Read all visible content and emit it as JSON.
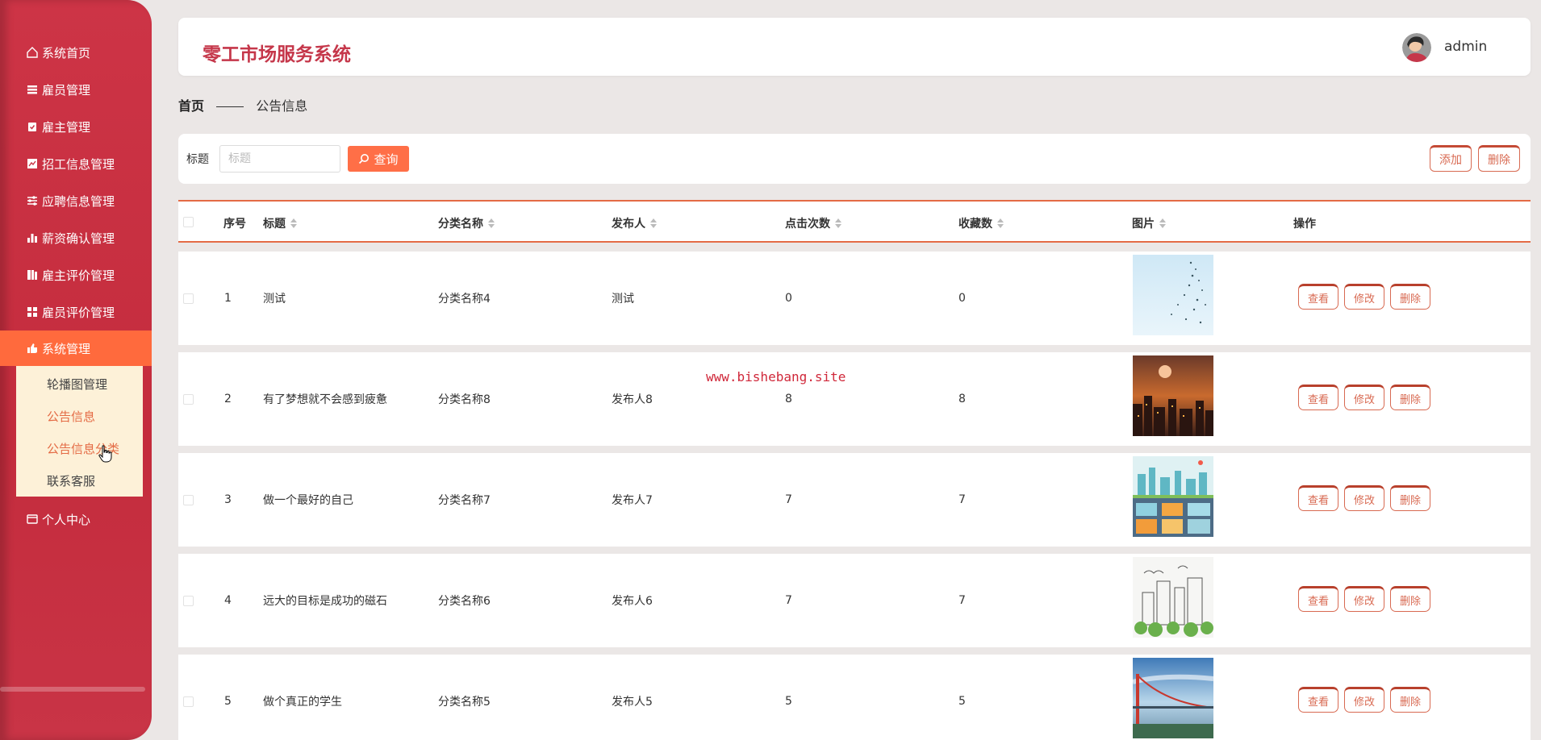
{
  "app": {
    "title": "零工市场服务系统",
    "username": "admin"
  },
  "sidebar": {
    "items": [
      {
        "label": "系统首页",
        "icon": "home-icon"
      },
      {
        "label": "雇员管理",
        "icon": "list-icon"
      },
      {
        "label": "雇主管理",
        "icon": "clipboard-icon"
      },
      {
        "label": "招工信息管理",
        "icon": "chart-icon"
      },
      {
        "label": "应聘信息管理",
        "icon": "sliders-icon"
      },
      {
        "label": "薪资确认管理",
        "icon": "bar-chart-icon"
      },
      {
        "label": "雇主评价管理",
        "icon": "book-icon"
      },
      {
        "label": "雇员评价管理",
        "icon": "grid-icon"
      },
      {
        "label": "系统管理",
        "icon": "thumbs-up-icon"
      },
      {
        "label": "个人中心",
        "icon": "card-icon"
      }
    ],
    "submenu": [
      "轮播图管理",
      "公告信息",
      "公告信息分类",
      "联系客服"
    ]
  },
  "breadcrumb": {
    "home": "首页",
    "current": "公告信息"
  },
  "search": {
    "label": "标题",
    "placeholder": "标题",
    "button": "查询",
    "add": "添加",
    "delete": "删除"
  },
  "table": {
    "columns": [
      "序号",
      "标题",
      "分类名称",
      "发布人",
      "点击次数",
      "收藏数",
      "图片",
      "操作"
    ],
    "rows": [
      {
        "no": "1",
        "title": "测试",
        "category": "分类名称4",
        "publisher": "测试",
        "clicks": "0",
        "favorites": "0"
      },
      {
        "no": "2",
        "title": "有了梦想就不会感到疲惫",
        "category": "分类名称8",
        "publisher": "发布人8",
        "clicks": "8",
        "favorites": "8"
      },
      {
        "no": "3",
        "title": "做一个最好的自己",
        "category": "分类名称7",
        "publisher": "发布人7",
        "clicks": "7",
        "favorites": "7"
      },
      {
        "no": "4",
        "title": "远大的目标是成功的磁石",
        "category": "分类名称6",
        "publisher": "发布人6",
        "clicks": "7",
        "favorites": "7"
      },
      {
        "no": "5",
        "title": "做个真正的学生",
        "category": "分类名称5",
        "publisher": "发布人5",
        "clicks": "5",
        "favorites": "5"
      }
    ],
    "actions": {
      "view": "查看",
      "edit": "修改",
      "delete": "删除"
    }
  },
  "watermark": "www.bishebang.site",
  "colors": {
    "sidebar": "#c93446",
    "accent": "#ff6a3d",
    "title": "#c5374a",
    "outline": "#d86a52"
  }
}
